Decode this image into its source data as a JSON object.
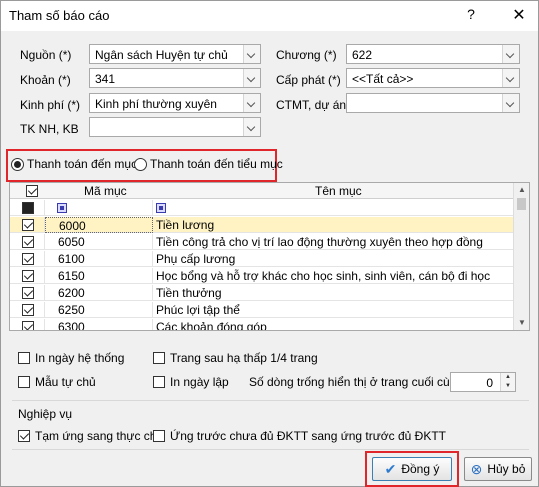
{
  "window": {
    "title": "Tham số báo cáo",
    "help": "?",
    "close": "✕"
  },
  "form": {
    "nguon": {
      "label": "Nguồn (*)",
      "value": "Ngân sách Huyện tự chủ"
    },
    "khoan": {
      "label": "Khoản (*)",
      "value": "341"
    },
    "kinh_phi": {
      "label": "Kinh phí (*)",
      "value": "Kinh phí thường xuyên"
    },
    "tknh": {
      "label": "TK NH, KB",
      "value": ""
    },
    "chuong": {
      "label": "Chương (*)",
      "value": "622"
    },
    "cap_phat": {
      "label": "Cấp phát (*)",
      "value": "<<Tất cả>>"
    },
    "ctmt": {
      "label": "CTMT, dự án",
      "value": ""
    }
  },
  "radios": [
    {
      "label": "Thanh toán đến mục",
      "selected": true
    },
    {
      "label": "Thanh toán đến tiểu mục",
      "selected": false
    }
  ],
  "grid": {
    "headers": {
      "check": "",
      "code": "Mã mục",
      "name": "Tên mục"
    },
    "rows": [
      {
        "code": "6000",
        "name": "Tiền lương",
        "checked": true,
        "selected": true
      },
      {
        "code": "6050",
        "name": "Tiền công trả cho vị trí lao động thường xuyên theo hợp đồng",
        "checked": true
      },
      {
        "code": "6100",
        "name": "Phụ cấp lương",
        "checked": true
      },
      {
        "code": "6150",
        "name": "Học bổng và hỗ trợ khác cho học sinh, sinh viên, cán bộ đi học",
        "checked": true
      },
      {
        "code": "6200",
        "name": "Tiền thưởng",
        "checked": true
      },
      {
        "code": "6250",
        "name": "Phúc lợi tập thể",
        "checked": true
      },
      {
        "code": "6300",
        "name": "Các khoản đóng góp",
        "checked": true
      }
    ]
  },
  "options": {
    "in_ngay_he_thong": "In ngày hệ thống",
    "mau_tu_chu": "Mẫu tự chủ",
    "trang_sau": "Trang sau hạ thấp 1/4 trang",
    "in_ngay_lap": "In ngày lập",
    "so_dong_label": "Số dòng trống hiển thị ở trang cuối cùng",
    "so_dong_value": "0"
  },
  "nghiep_vu": {
    "title": "Nghiệp vụ",
    "tam_ung": "Tạm ứng sang thực chi",
    "ung_truoc": "Ứng trước chưa đủ ĐKTT sang ứng trước đủ ĐKTT"
  },
  "buttons": {
    "ok": "Đồng ý",
    "cancel": "Hủy bỏ"
  },
  "colors": {
    "highlight_red": "#e0262b",
    "selected_row": "#fff3c4"
  }
}
